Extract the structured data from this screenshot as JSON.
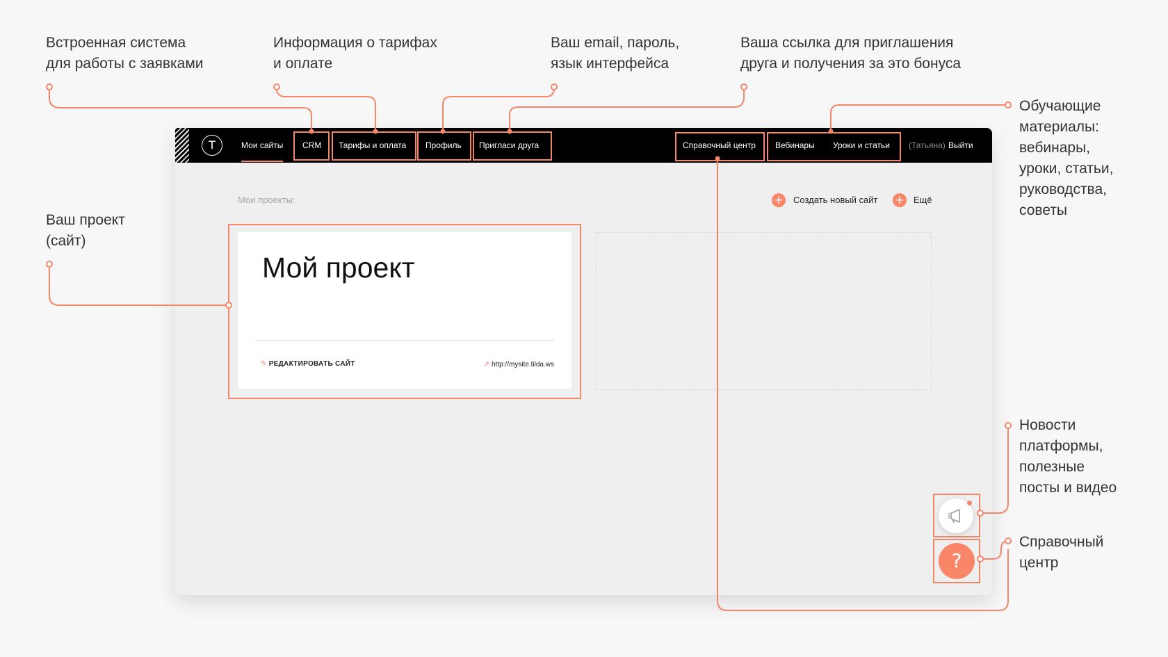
{
  "annotations": {
    "crm": "Встроенная система\nдля работы с заявками",
    "tariffs": "Информация о тарифах\nи оплате",
    "profile": "Ваш email, пароль,\nязык интерфейса",
    "invite": "Ваша ссылка для приглашения\nдруга и получения за это бонуса",
    "learning": "Обучающие\nматериалы:\nвебинары,\nуроки, статьи,\nруководства,\nсоветы",
    "project": "Ваш проект\n(сайт)",
    "news": "Новости\nплатформы,\nполезные\nпосты и видео",
    "help": "Справочный\nцентр"
  },
  "topbar": {
    "logo_glyph": "T",
    "nav": {
      "my_sites": "Мои сайты",
      "crm": "CRM",
      "tariffs": "Тарифы и оплата",
      "profile": "Профиль",
      "invite": "Пригласи друга",
      "help_center": "Справочный центр",
      "webinars": "Вебинары",
      "lessons": "Уроки и статьи",
      "user_name": "(Татьяна)",
      "logout": "Выйти"
    }
  },
  "main": {
    "section_label": "Мои проекты:",
    "create_site": "Создать новый сайт",
    "more": "Ещё",
    "project": {
      "title": "Мой проект",
      "edit_label": "РЕДАКТИРОВАТЬ САЙТ",
      "url": "http://mysite.tilda.ws"
    }
  },
  "widgets": {
    "help_glyph": "?",
    "news_icon": "megaphone-icon"
  },
  "colors": {
    "accent": "#fa8669",
    "topbar": "#000000",
    "highlight": "#f4866a"
  }
}
